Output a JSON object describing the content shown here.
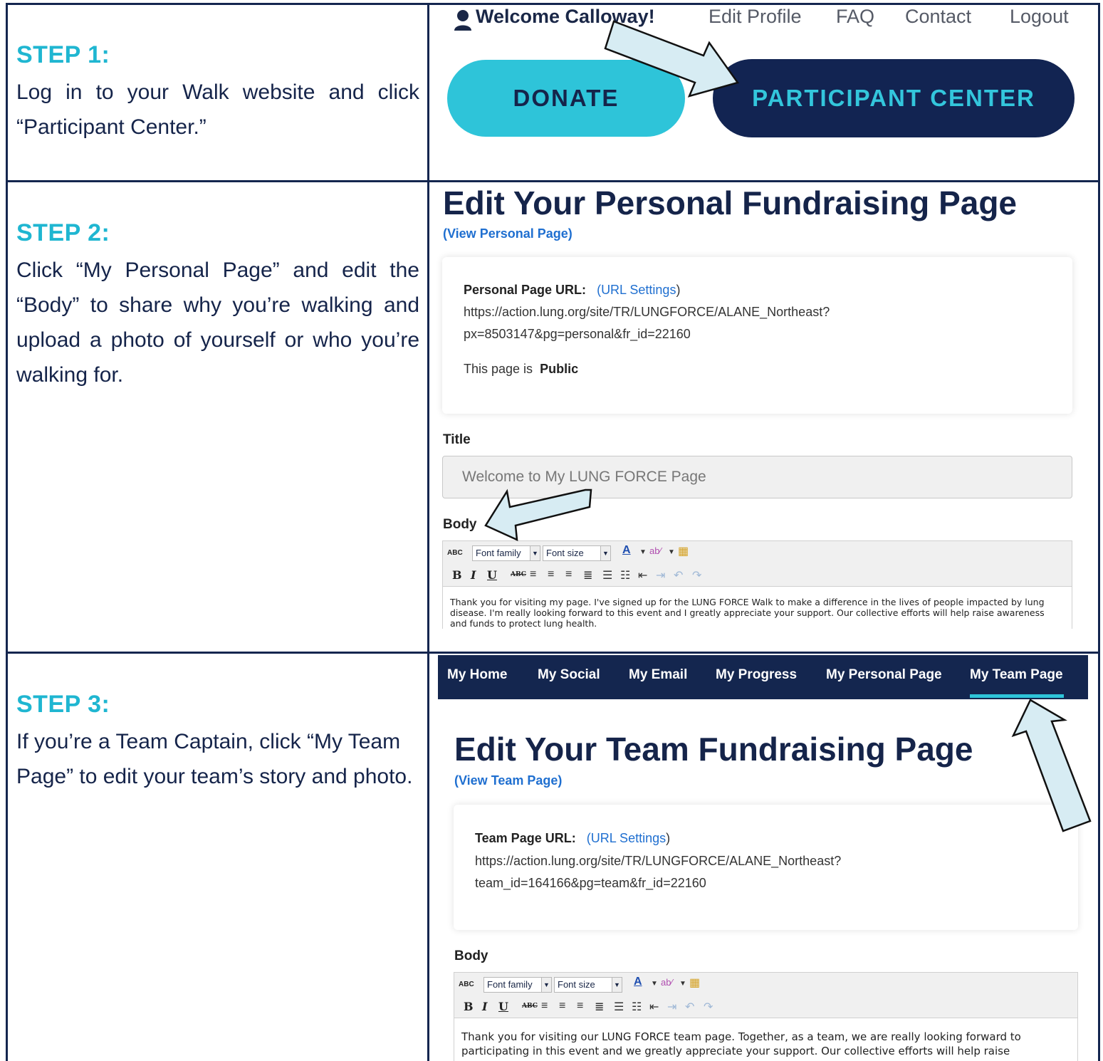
{
  "steps": [
    {
      "title": "STEP 1:",
      "text": "Log in to your Walk website and click “Participant Center.”"
    },
    {
      "title": "STEP 2:",
      "text": "Click “My Personal Page” and edit the “Body” to share why you’re walking and upload a photo of yourself or who you’re walking for."
    },
    {
      "title": "STEP 3:",
      "text": "If you’re a Team Captain, click “My Team Page” to edit your team’s story and photo."
    }
  ],
  "site_nav": {
    "welcome": "Welcome Calloway!",
    "edit_profile": "Edit Profile",
    "faq": "FAQ",
    "contact": "Contact",
    "logout": "Logout"
  },
  "buttons": {
    "donate": "DONATE",
    "participant_center": "PARTICIPANT CENTER"
  },
  "personal": {
    "heading": "Edit Your Personal Fundraising Page",
    "view_link": "(View Personal Page)",
    "url_label": "Personal Page URL:",
    "url_settings_open": "(",
    "url_settings": "URL Settings",
    "url_settings_close": ")",
    "url_line1": "https://action.lung.org/site/TR/LUNGFORCE/ALANE_Northeast?",
    "url_line2": "px=8503147&pg=personal&fr_id=22160",
    "visibility_prefix": "This page is",
    "visibility_value": "Public",
    "title_label": "Title",
    "title_value": "Welcome to My LUNG FORCE Page",
    "body_label": "Body",
    "body_text": "Thank you for visiting my page. I've signed up for the LUNG FORCE Walk to make a difference in the lives of people impacted by lung disease. I'm really looking forward to this event and I greatly appreciate your support. Our collective efforts will help raise awareness and funds to protect lung health."
  },
  "editor_toolbar": {
    "spellcheck": "ABC",
    "font_family": "Font family",
    "font_size": "Font size",
    "bold": "B",
    "italic": "I",
    "underline": "U",
    "strike": "ABC"
  },
  "tabs": [
    "My Home",
    "My Social",
    "My Email",
    "My Progress",
    "My Personal Page",
    "My Team Page"
  ],
  "team": {
    "heading": "Edit Your Team Fundraising Page",
    "view_link": "(View Team Page)",
    "url_label": "Team Page URL:",
    "url_settings_open": "(",
    "url_settings": "URL Settings",
    "url_settings_close": ")",
    "url_line1": "https://action.lung.org/site/TR/LUNGFORCE/ALANE_Northeast?",
    "url_line2": "team_id=164166&pg=team&fr_id=22160",
    "body_label": "Body",
    "body_text": "Thank you for visiting our LUNG FORCE team page. Together, as a team, we are really looking forward to participating in this event and we greatly appreciate your support. Our collective efforts will help raise"
  },
  "colors": {
    "navy": "#14264f",
    "teal": "#2ec4d9",
    "link_blue": "#1f6fd0",
    "arrow_fill": "#d7ecf3"
  },
  "icons": [
    "user-icon",
    "pointer-arrow-icon",
    "spellcheck-icon",
    "font-color-icon",
    "highlight-icon",
    "paste-word-icon",
    "align-left-icon",
    "align-center-icon",
    "align-right-icon",
    "justify-icon",
    "bullet-list-icon",
    "number-list-icon",
    "outdent-icon",
    "indent-icon",
    "undo-icon",
    "redo-icon"
  ]
}
